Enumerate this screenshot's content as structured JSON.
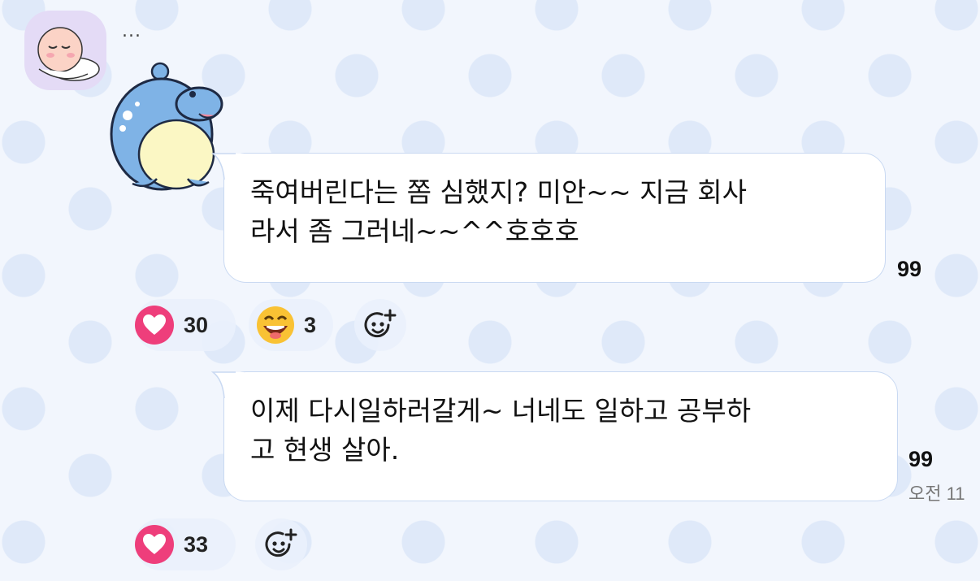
{
  "sender": {
    "name": "..."
  },
  "messages": [
    {
      "text_line1": "죽여버린다는 쫌 심했지? 미안~~ 지금 회사",
      "text_line2": "라서 좀 그러네~~^^호호호",
      "read_count": "99",
      "reactions": {
        "heart_count": "30",
        "laugh_count": "3"
      }
    },
    {
      "text_line1": "이제 다시일하러갈게~ 너네도 일하고 공부하",
      "text_line2": "고 현생 살아.",
      "read_count": "99",
      "time": "오전 11",
      "reactions": {
        "heart_count": "33"
      }
    }
  ],
  "icons": {
    "heart": "heart-icon",
    "laugh": "laughing-emoji-icon",
    "add_reaction": "add-reaction-icon"
  },
  "colors": {
    "heart": "#ee3e7b",
    "bubble_border": "#c9d9f2",
    "background": "#f2f6fd"
  }
}
